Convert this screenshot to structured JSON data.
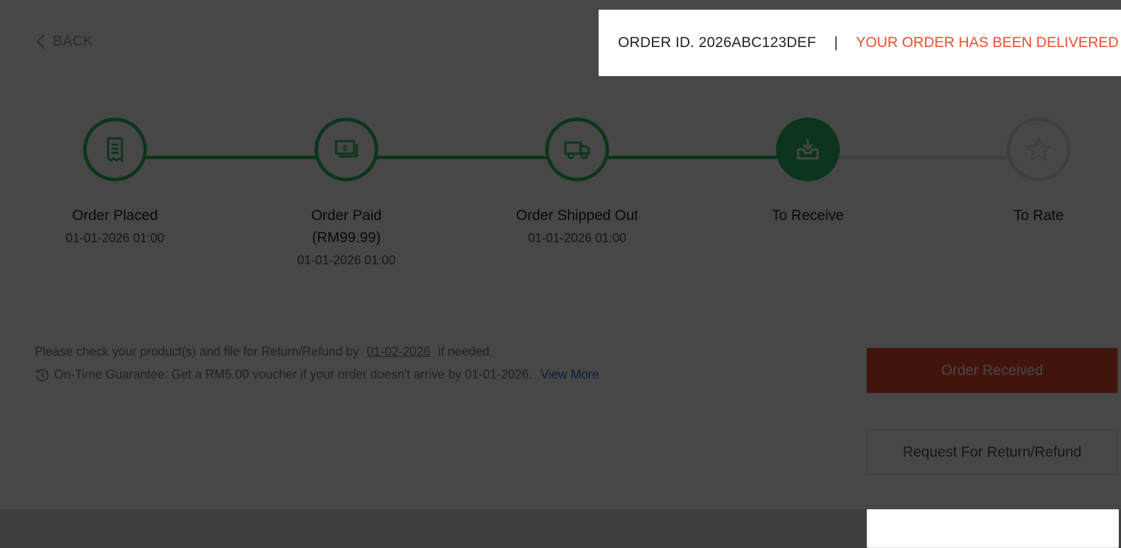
{
  "back": {
    "label": "BACK"
  },
  "order": {
    "id_text": "ORDER ID. 2026ABC123DEF",
    "separator": "|",
    "status_text": "YOUR ORDER HAS BEEN DELIVERED"
  },
  "steps": [
    {
      "title": "Order Placed",
      "title2": "",
      "time": "01-01-2026 01:00",
      "icon": "receipt-icon",
      "state": "done"
    },
    {
      "title": "Order Paid",
      "title2": "(RM99.99)",
      "time": "01-01-2026 01:00",
      "icon": "money-icon",
      "state": "done"
    },
    {
      "title": "Order Shipped Out",
      "title2": "",
      "time": "01-01-2026 01:00",
      "icon": "truck-icon",
      "state": "done"
    },
    {
      "title": "To Receive",
      "title2": "",
      "time": "",
      "icon": "inbox-download-icon",
      "state": "current"
    },
    {
      "title": "To Rate",
      "title2": "",
      "time": "",
      "icon": "star-icon",
      "state": "pending"
    }
  ],
  "notice": {
    "check_prefix": "Please check your product(s) and file for Return/Refund by ",
    "check_date": "01-02-2026",
    "check_suffix": " if needed.",
    "guarantee_icon": "clock-refresh-icon",
    "guarantee_text": "On-Time Guarantee: Get a RM5.00 voucher if your order doesn't arrive by 01-01-2026.",
    "view_more": "View More"
  },
  "buttons": {
    "order_received": "Order Received",
    "return_refund": "Request For Return/Refund"
  },
  "colors": {
    "brand": "#ee4d2d",
    "progress": "#2dbe60",
    "pending": "#dedede",
    "link": "#1f6fd6"
  }
}
